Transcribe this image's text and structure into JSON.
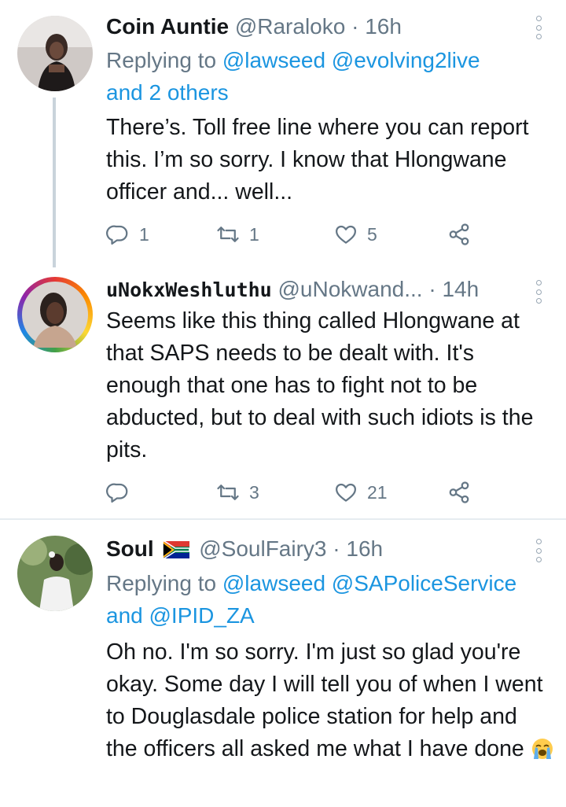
{
  "tweets": [
    {
      "name": "Coin Auntie",
      "handle": "@Raraloko",
      "dot": "·",
      "time": "16h",
      "replying_prefix": "Replying to",
      "replying_links": "@lawseed @evolving2live",
      "replying_suffix_link": "and 2 others",
      "text": "There’s. Toll free line where you can report this. I’m so sorry. I know that Hlongwane officer and... well...",
      "reply_count": "1",
      "retweet_count": "1",
      "like_count": "5"
    },
    {
      "name": "uNokxWeshluthu",
      "handle": "@uNokwand...",
      "dot": "·",
      "time": "14h",
      "text": "Seems like this thing called Hlongwane at that SAPS needs to be dealt with. It's enough that one has to fight not to be abducted, but to deal with such idiots is the pits.",
      "reply_count": "",
      "retweet_count": "3",
      "like_count": "21"
    },
    {
      "name": "Soul",
      "handle": "@SoulFairy3",
      "dot": "·",
      "time": "16h",
      "replying_prefix": "Replying to",
      "replying_links": "@lawseed @SAPoliceService",
      "replying_and": "and",
      "replying_last": "@IPID_ZA",
      "text": "Oh no. I'm so sorry. I'm just so glad you're okay. Some day I will tell you of when I went to Douglasdale police station for help and the officers all asked me what I have done"
    }
  ],
  "icons": {
    "reply": "reply-icon",
    "retweet": "retweet-icon",
    "like": "heart-icon",
    "share": "share-icon",
    "more": "more-vertical-icon",
    "flag": "south-africa-flag-icon",
    "emoji": "loudly-crying-face-emoji"
  },
  "colors": {
    "link": "#1b95e0",
    "secondary_text": "#657786",
    "thread_line": "#c9d3db",
    "divider": "#e6ecf0"
  }
}
